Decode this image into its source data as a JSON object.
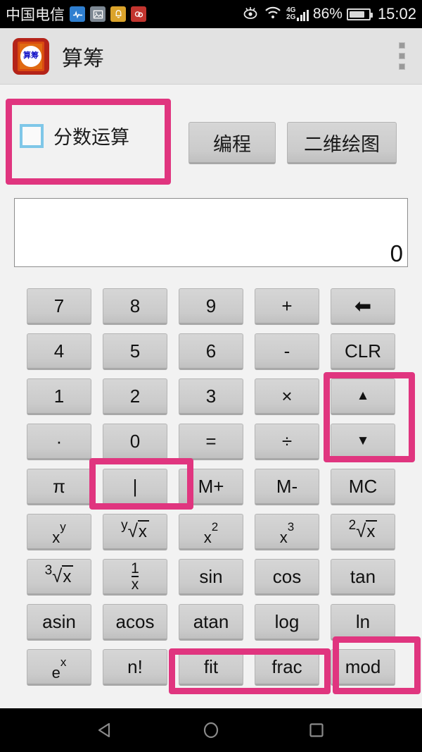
{
  "status_bar": {
    "carrier": "中国电信",
    "notification_icons": [
      {
        "name": "heartbeat-icon",
        "color": "#2f7fd0"
      },
      {
        "name": "image-icon",
        "color": "#7d8893"
      },
      {
        "name": "bell-icon",
        "color": "#dba32b"
      },
      {
        "name": "clouds-icon",
        "color": "#c3352f"
      }
    ],
    "eye_icon": "eye-icon",
    "wifi_icon": "wifi-icon",
    "network_primary": "4G",
    "network_secondary": "2G",
    "battery_percent": "86%",
    "time": "15:02"
  },
  "action_bar": {
    "app_title": "算筹",
    "logo_text": "算筹",
    "overflow_menu": "overflow-menu"
  },
  "top_controls": {
    "fraction_checkbox_label": "分数运算",
    "fraction_checkbox_checked": false,
    "programming_button": "编程",
    "plot2d_button": "二维绘图"
  },
  "display": {
    "value": "0"
  },
  "keypad": {
    "rows": [
      [
        {
          "name": "key-7",
          "label": "7",
          "type": "plain"
        },
        {
          "name": "key-8",
          "label": "8",
          "type": "plain"
        },
        {
          "name": "key-9",
          "label": "9",
          "type": "plain"
        },
        {
          "name": "key-plus",
          "label": "+",
          "type": "plain"
        },
        {
          "name": "key-backspace",
          "label": "⬅",
          "type": "glyph-back"
        }
      ],
      [
        {
          "name": "key-4",
          "label": "4",
          "type": "plain"
        },
        {
          "name": "key-5",
          "label": "5",
          "type": "plain"
        },
        {
          "name": "key-6",
          "label": "6",
          "type": "plain"
        },
        {
          "name": "key-minus",
          "label": "-",
          "type": "plain"
        },
        {
          "name": "key-clear",
          "label": "CLR",
          "type": "plain"
        }
      ],
      [
        {
          "name": "key-1",
          "label": "1",
          "type": "plain"
        },
        {
          "name": "key-2",
          "label": "2",
          "type": "plain"
        },
        {
          "name": "key-3",
          "label": "3",
          "type": "plain"
        },
        {
          "name": "key-multiply",
          "label": "×",
          "type": "plain"
        },
        {
          "name": "key-arrow-up",
          "label": "▲",
          "type": "glyph-arrow"
        }
      ],
      [
        {
          "name": "key-decimal",
          "label": "·",
          "type": "plain"
        },
        {
          "name": "key-0",
          "label": "0",
          "type": "plain"
        },
        {
          "name": "key-equals",
          "label": "=",
          "type": "plain"
        },
        {
          "name": "key-divide",
          "label": "÷",
          "type": "plain"
        },
        {
          "name": "key-arrow-down",
          "label": "▼",
          "type": "glyph-arrow"
        }
      ],
      [
        {
          "name": "key-pi",
          "label": "π",
          "type": "plain"
        },
        {
          "name": "key-pipe",
          "label": "|",
          "type": "plain"
        },
        {
          "name": "key-mem-add",
          "label": "M+",
          "type": "plain"
        },
        {
          "name": "key-mem-sub",
          "label": "M-",
          "type": "plain"
        },
        {
          "name": "key-mem-clear",
          "label": "MC",
          "type": "plain"
        }
      ],
      [
        {
          "name": "key-x-pow-y",
          "label": "x^y",
          "type": "pow",
          "base": "x",
          "exp": "y"
        },
        {
          "name": "key-yth-root",
          "label": "y√x",
          "type": "radical",
          "index": "y",
          "arg": "x"
        },
        {
          "name": "key-x-squared",
          "label": "x²",
          "type": "pow",
          "base": "x",
          "exp": "2"
        },
        {
          "name": "key-x-cubed",
          "label": "x³",
          "type": "pow",
          "base": "x",
          "exp": "3"
        },
        {
          "name": "key-sqrt",
          "label": "2√x",
          "type": "radical",
          "index": "2",
          "arg": "x"
        }
      ],
      [
        {
          "name": "key-cube-root",
          "label": "3√x",
          "type": "radical",
          "index": "3",
          "arg": "x"
        },
        {
          "name": "key-reciprocal",
          "label": "1/x",
          "type": "frac",
          "num": "1",
          "den": "x"
        },
        {
          "name": "key-sin",
          "label": "sin",
          "type": "plain"
        },
        {
          "name": "key-cos",
          "label": "cos",
          "type": "plain"
        },
        {
          "name": "key-tan",
          "label": "tan",
          "type": "plain"
        }
      ],
      [
        {
          "name": "key-asin",
          "label": "asin",
          "type": "plain"
        },
        {
          "name": "key-acos",
          "label": "acos",
          "type": "plain"
        },
        {
          "name": "key-atan",
          "label": "atan",
          "type": "plain"
        },
        {
          "name": "key-log",
          "label": "log",
          "type": "plain"
        },
        {
          "name": "key-ln",
          "label": "ln",
          "type": "plain"
        }
      ],
      [
        {
          "name": "key-e-pow-x",
          "label": "e^x",
          "type": "pow",
          "base": "e",
          "exp": "x"
        },
        {
          "name": "key-factorial",
          "label": "n!",
          "type": "plain"
        },
        {
          "name": "key-fit",
          "label": "fit",
          "type": "plain"
        },
        {
          "name": "key-frac",
          "label": "frac",
          "type": "plain"
        },
        {
          "name": "key-mod",
          "label": "mod",
          "type": "plain"
        }
      ]
    ]
  },
  "highlights": {
    "color": "#e0357f",
    "boxes": [
      {
        "name": "highlight-fraction-checkbox",
        "target": "分数运算"
      },
      {
        "name": "highlight-scroll-arrows",
        "target": "▲ ▼"
      },
      {
        "name": "highlight-pipe-key",
        "target": "|"
      },
      {
        "name": "highlight-fit-frac-keys",
        "target": "fit frac"
      },
      {
        "name": "highlight-mod-key",
        "target": "mod"
      }
    ]
  },
  "nav_bar": {
    "back": "back-icon",
    "home": "home-icon",
    "recents": "recents-icon"
  }
}
